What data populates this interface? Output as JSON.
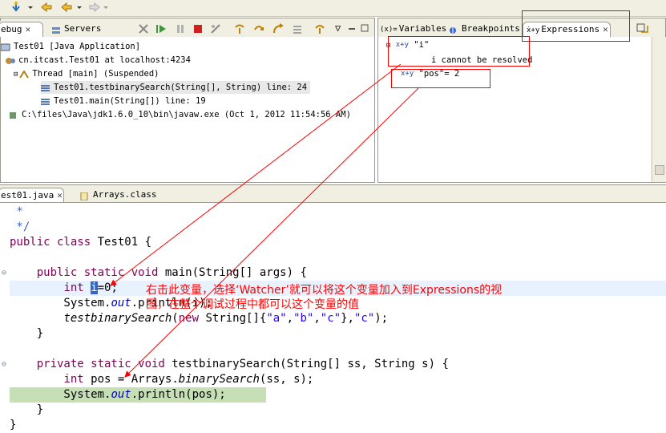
{
  "toolbar": {
    "icons": [
      "debug-run-icon",
      "dropdown-icon",
      "back-icon",
      "back-dropdown-icon",
      "forward-icon",
      "forward-dropdown-icon"
    ]
  },
  "debug_view": {
    "tabs": [
      {
        "label": "ebug",
        "active": true
      },
      {
        "label": "Servers",
        "active": false
      }
    ],
    "tree": [
      {
        "label": "Test01 [Java Application]",
        "level": 0
      },
      {
        "label": "cn.itcast.Test01 at localhost:4234",
        "level": 1
      },
      {
        "label": "Thread [main] (Suspended)",
        "level": 2
      },
      {
        "label": "Test01.testbinarySearch(String[], String) line: 24",
        "level": 3,
        "selected": true
      },
      {
        "label": "Test01.main(String[]) line: 19",
        "level": 3
      },
      {
        "label": "C:\\files\\Java\\jdk1.6.0_10\\bin\\javaw.exe (Oct 1, 2012 11:54:56 AM)",
        "level": 1
      }
    ]
  },
  "vars_view": {
    "tabs": [
      {
        "label": "Variables",
        "active": false
      },
      {
        "label": "Breakpoints",
        "active": false
      },
      {
        "label": "Expressions",
        "active": true
      }
    ],
    "expressions": [
      {
        "name": "\"i\"",
        "child": "i cannot be resolved"
      },
      {
        "name": "\"pos\"= 2"
      }
    ],
    "expr_icon_label": "x+y"
  },
  "editor": {
    "tabs": [
      {
        "label": "est01.java",
        "active": true
      },
      {
        "label": "Arrays.class",
        "active": false
      }
    ],
    "annotation": {
      "line1": "右击此变量，选择‘Watcher’就可以将这个变量加入到Expressions的视",
      "line2": "图，在整个调试过程中都可以这个变量的值"
    }
  },
  "colors": {
    "annotation": "#ff0000",
    "keyword": "#7f0055",
    "field": "#0000c0",
    "string": "#2a00ff",
    "current_line": "#c7dfb5",
    "highlight_line": "#e8f2fe",
    "chrome": "#f1efe2"
  }
}
